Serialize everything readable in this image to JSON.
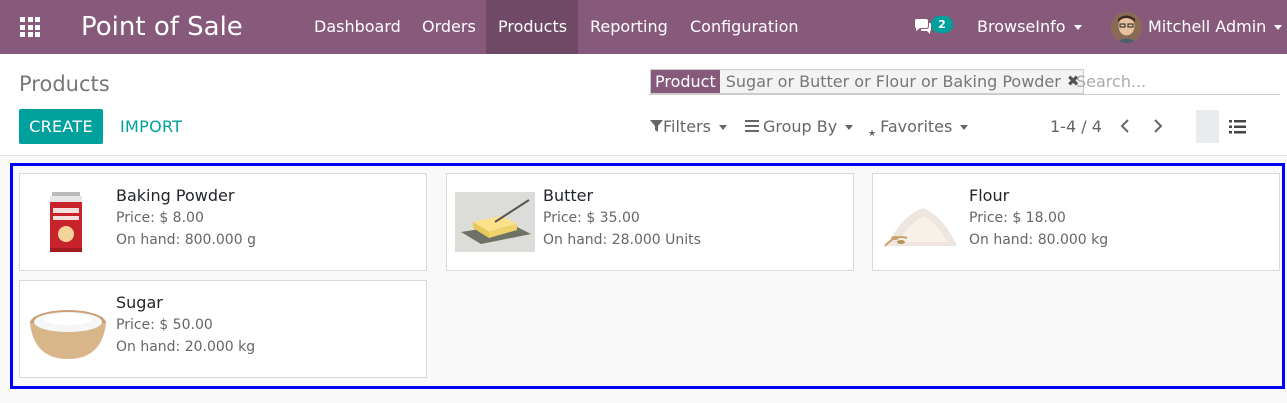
{
  "navbar": {
    "app_name": "Point of Sale",
    "menu": [
      "Dashboard",
      "Orders",
      "Products",
      "Reporting",
      "Configuration"
    ],
    "active_menu": "Products",
    "chat_count": "2",
    "company": "BrowseInfo",
    "user": "Mitchell Admin"
  },
  "control_panel": {
    "breadcrumb": "Products",
    "create_label": "CREATE",
    "import_label": "IMPORT",
    "search": {
      "facet_label": "Product",
      "facet_values": "Sugar or Butter or Flour or Baking Powder",
      "placeholder": "Search..."
    },
    "filters_label": "Filters",
    "group_by_label": "Group By",
    "favorites_label": "Favorites",
    "pager": "1-4 / 4"
  },
  "products": [
    {
      "name": "Baking Powder",
      "price": "Price: $ 8.00",
      "on_hand": "On hand: 800.000 g",
      "image": "baking-powder-can"
    },
    {
      "name": "Butter",
      "price": "Price: $ 35.00",
      "on_hand": "On hand: 28.000 Units",
      "image": "butter-dish"
    },
    {
      "name": "Flour",
      "price": "Price: $ 18.00",
      "on_hand": "On hand: 80.000 kg",
      "image": "flour-pile"
    },
    {
      "name": "Sugar",
      "price": "Price: $ 50.00",
      "on_hand": "On hand: 20.000 kg",
      "image": "sugar-bowl"
    }
  ],
  "colors": {
    "brand": "#875a7b",
    "accent": "#00a09d",
    "highlight_border": "#0000ff"
  }
}
